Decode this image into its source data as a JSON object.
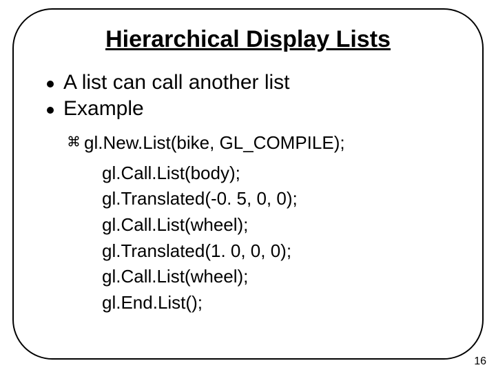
{
  "title": "Hierarchical Display Lists",
  "bullets": [
    "A list can call another list",
    "Example"
  ],
  "code": {
    "first": "gl.New.List(bike, GL_COMPILE);",
    "rest": [
      "gl.Call.List(body);",
      "gl.Translated(-0. 5, 0, 0);",
      "gl.Call.List(wheel);",
      "gl.Translated(1. 0, 0, 0);",
      "gl.Call.List(wheel);",
      "gl.End.List();"
    ]
  },
  "icons": {
    "cmd": "command-icon"
  },
  "page_number": "16"
}
